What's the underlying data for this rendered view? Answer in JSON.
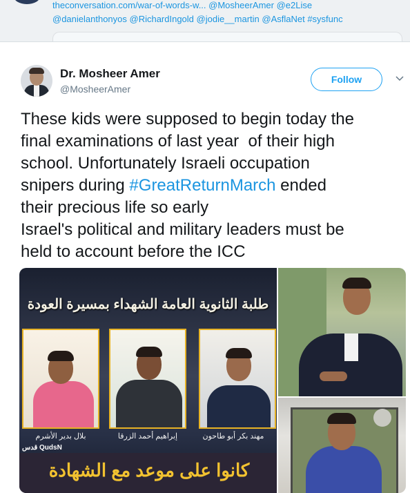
{
  "previous_tweet": {
    "line1_link": "theconversation.com/war-of-words-w...",
    "line1_mention": "@MosheerAmer @e2Lise",
    "line2": "@danielanthonyos @RichardIngold @jodie__martin @AsflaNet #sysfunc"
  },
  "tweet": {
    "author_name": "Dr. Mosheer Amer",
    "author_handle": "@MosheerAmer",
    "follow_label": "Follow",
    "text_lines": [
      "These kids were supposed to begin today the",
      "final examinations of last year  of their high",
      "school. Unfortunately Israeli occupation",
      "snipers during ",
      "#GreatReturnMarch",
      " ended",
      "their precious life so early",
      "Israel's political and military leaders must be",
      "held to account before the ICC"
    ]
  },
  "poster": {
    "title": "طلبة الثانوية العامة الشهداء بمسيرة العودة",
    "names": [
      "مهند بكر أبو طاحون",
      "إبراهيم أحمد الزرقا",
      "بلال بدير الأشرم"
    ],
    "logo": "قدس QudsN",
    "bottom": "كانوا على موعد مع الشهادة"
  },
  "icons": [
    "chevron-down-icon"
  ],
  "colors": {
    "link": "#1b95e0",
    "follow": "#1da1f2",
    "text": "#14171a",
    "muted": "#657786"
  }
}
